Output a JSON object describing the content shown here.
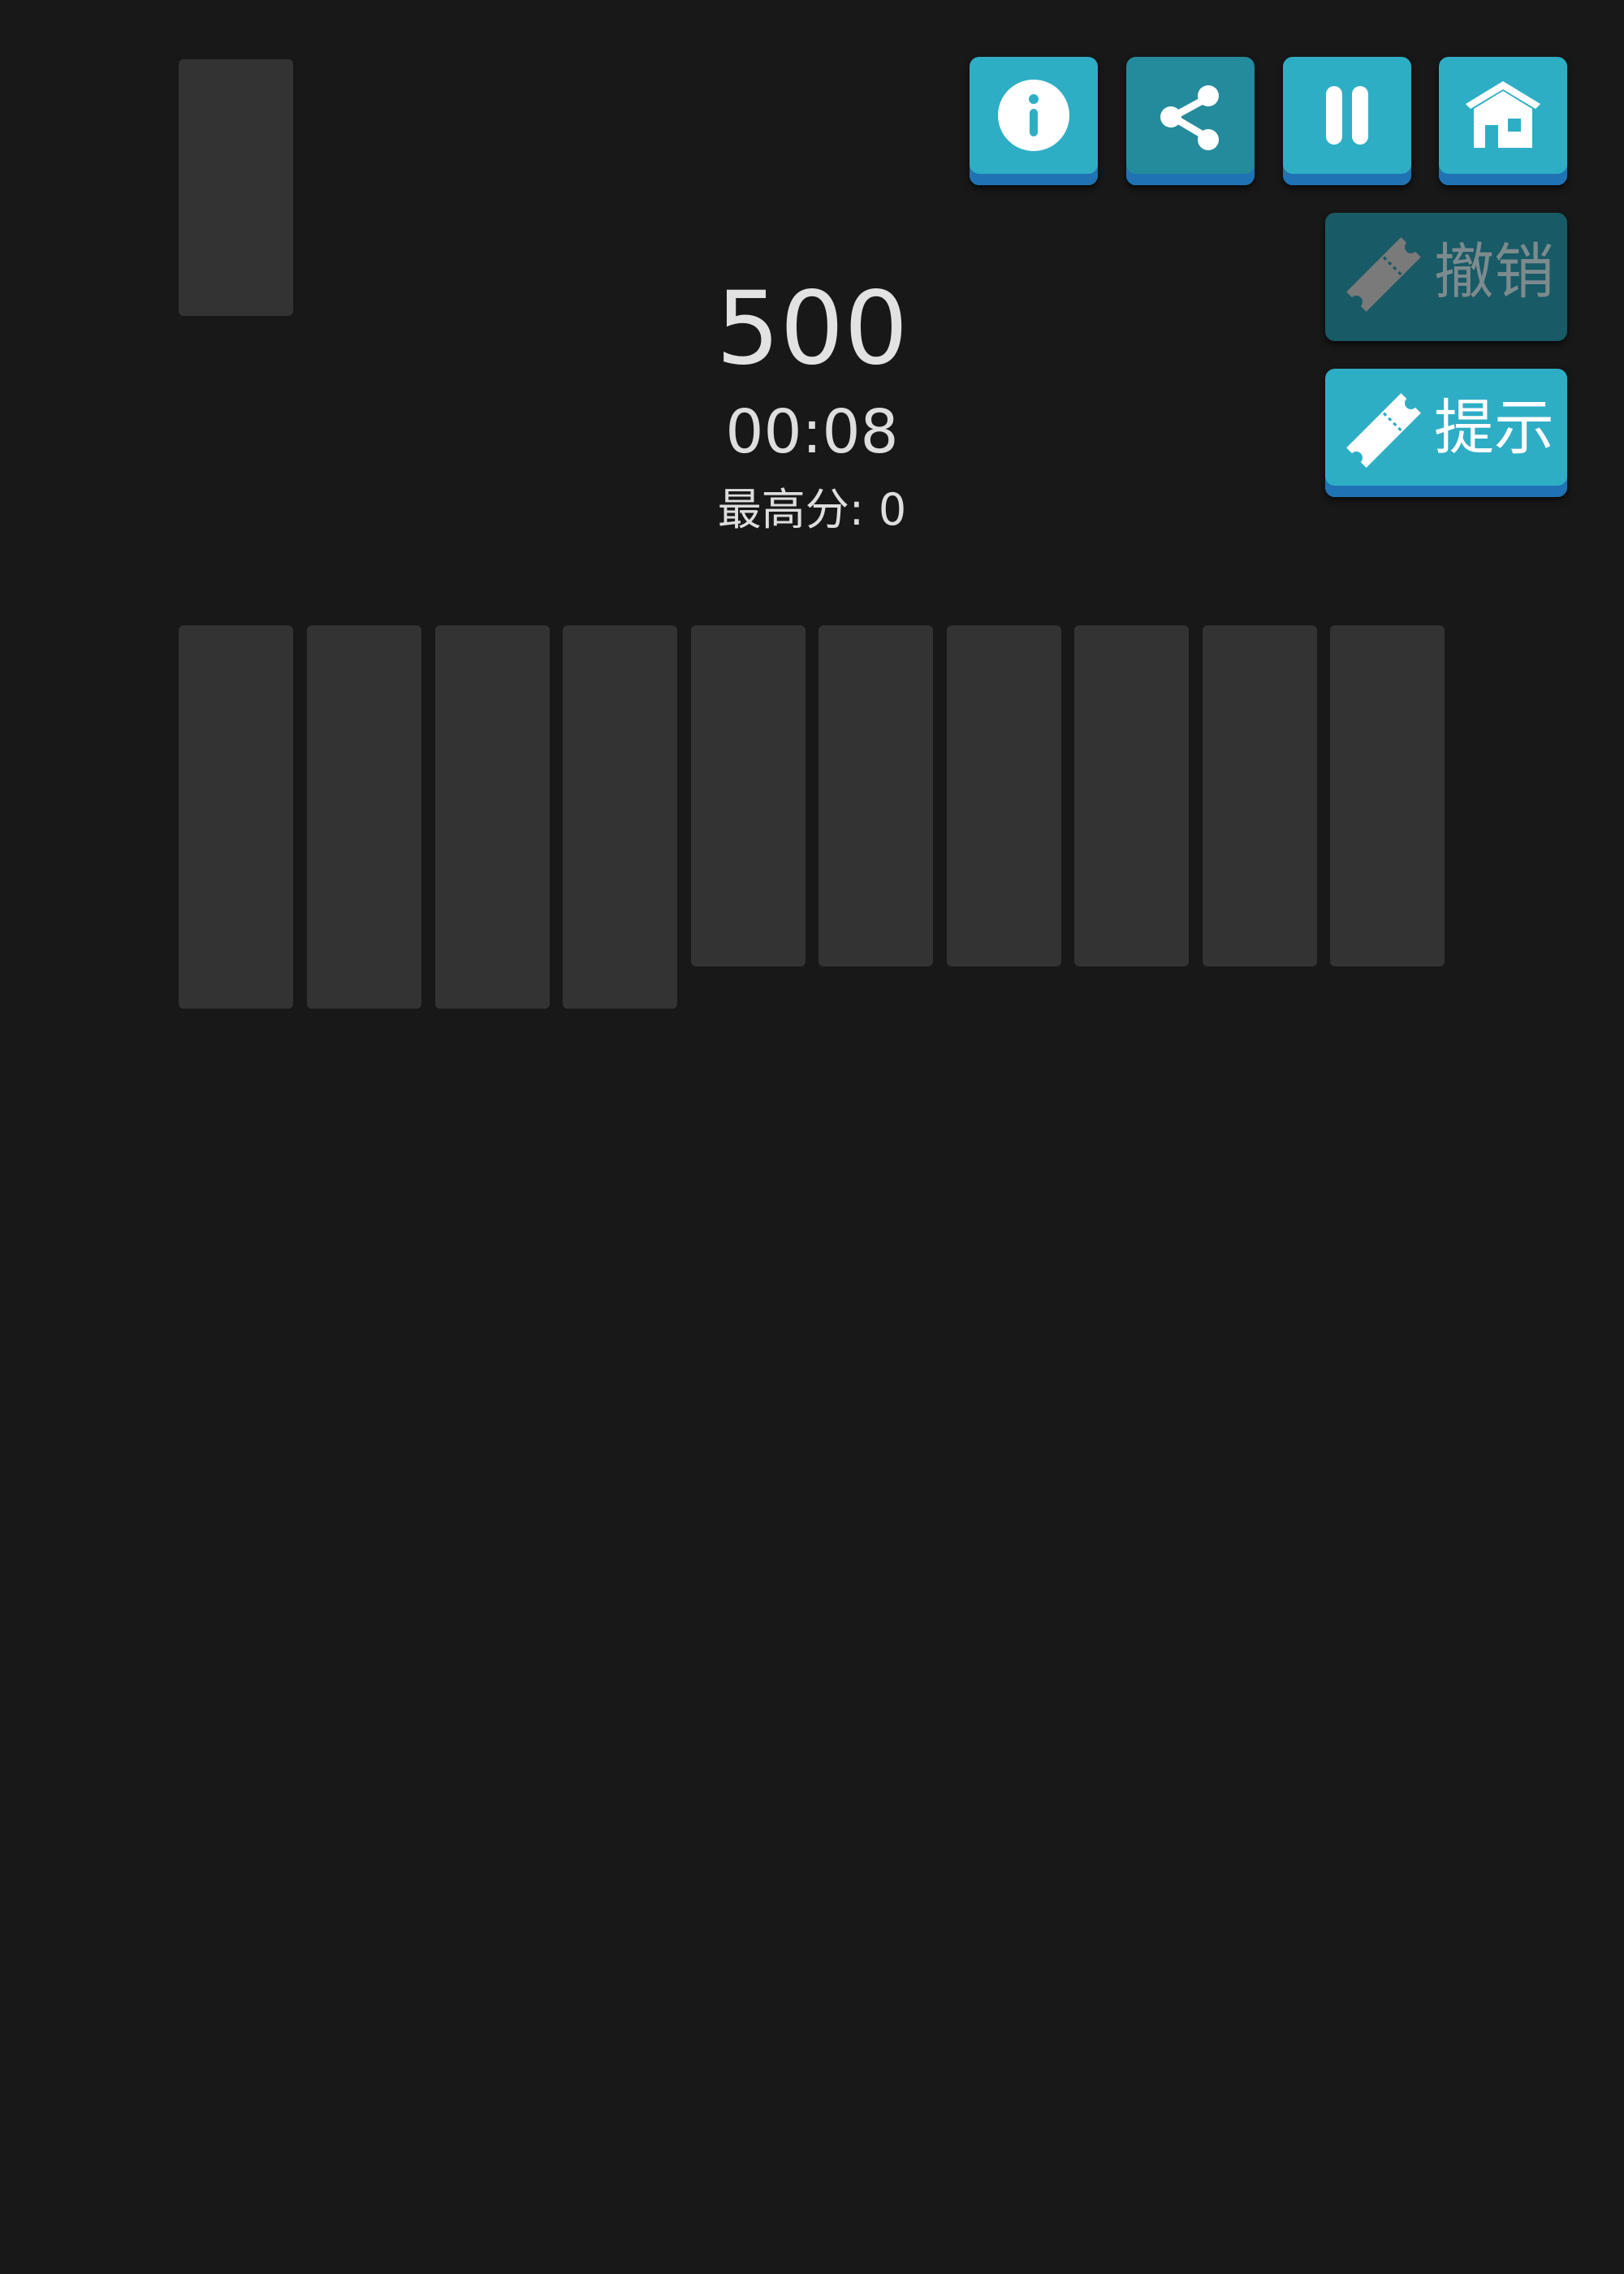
{
  "header": {
    "buttons": {
      "info": {
        "icon": "info-icon"
      },
      "share": {
        "icon": "share-icon"
      },
      "pause": {
        "icon": "pause-icon"
      },
      "home": {
        "icon": "home-icon"
      }
    },
    "undo": {
      "label": "撤销",
      "icon": "ticket-icon",
      "enabled": false
    },
    "hint": {
      "label": "提示",
      "icon": "ticket-icon",
      "enabled": true
    }
  },
  "stats": {
    "score": "500",
    "timer": "00:08",
    "best_label": "最高分:",
    "best_value": "0"
  },
  "board": {
    "stock": {
      "face_down": true
    },
    "tableau_column_count": 10
  },
  "colors": {
    "background": "#181818",
    "card_back": "#333333",
    "button_primary": "#2eaec5",
    "button_shadow": "#1f73b5",
    "button_share": "#248b9c",
    "button_disabled": "#185a65"
  }
}
